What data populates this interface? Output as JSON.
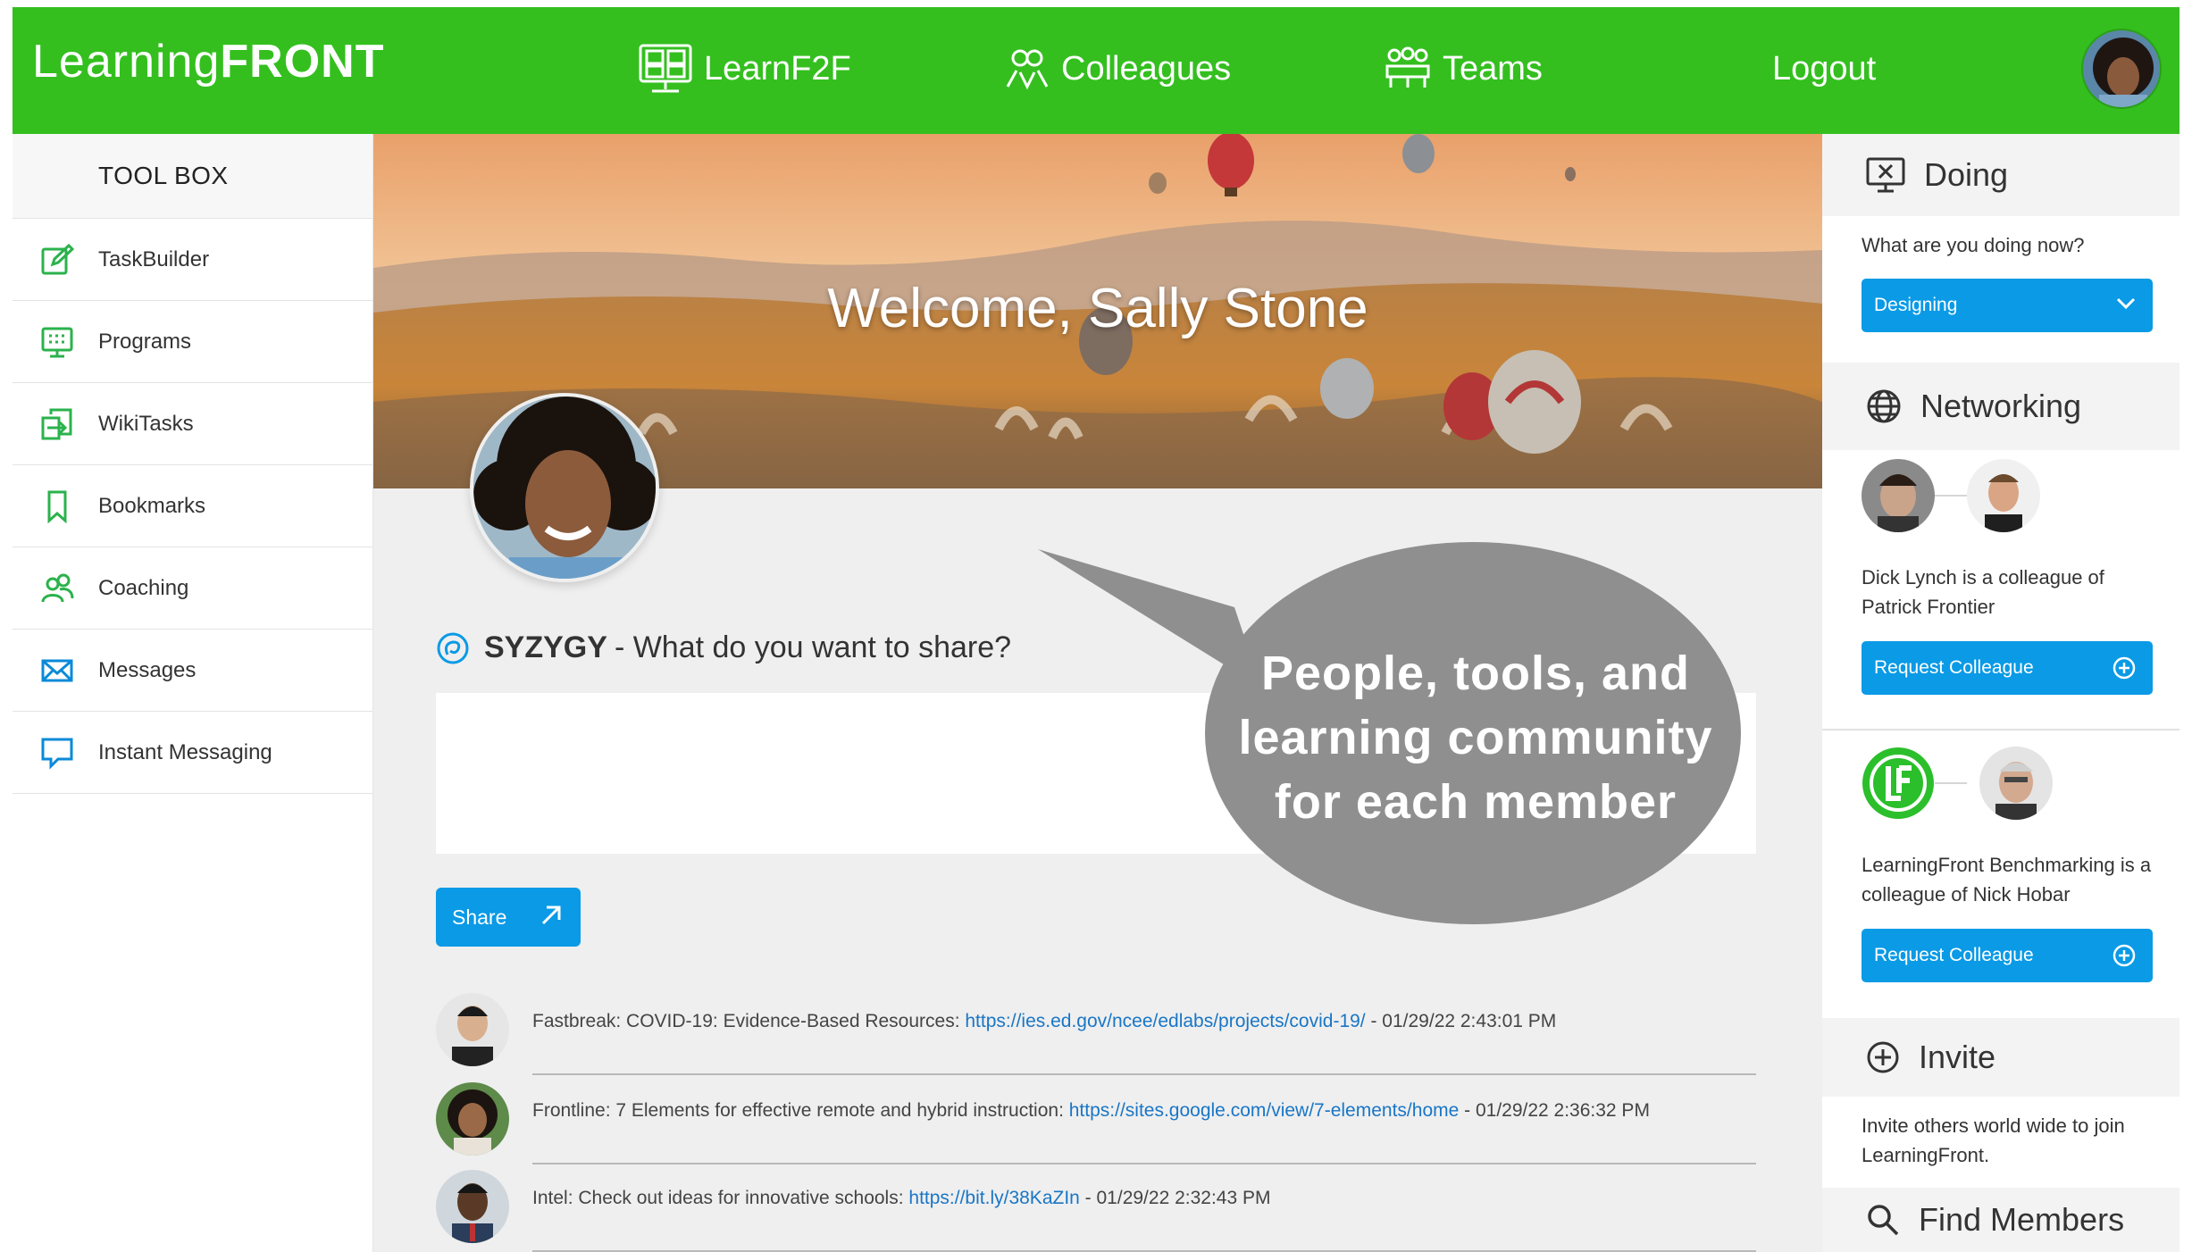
{
  "app": {
    "logo_part1": "Learning",
    "logo_part2": "FRONT"
  },
  "nav": {
    "learnf2f": "LearnF2F",
    "colleagues": "Colleagues",
    "teams": "Teams",
    "logout": "Logout"
  },
  "sidebar": {
    "title": "TOOL BOX",
    "items": [
      {
        "label": "TaskBuilder",
        "icon": "edit-icon"
      },
      {
        "label": "Programs",
        "icon": "monitor-grid-icon"
      },
      {
        "label": "WikiTasks",
        "icon": "import-icon"
      },
      {
        "label": "Bookmarks",
        "icon": "bookmark-icon"
      },
      {
        "label": "Coaching",
        "icon": "users-icon"
      },
      {
        "label": "Messages",
        "icon": "envelope-icon"
      },
      {
        "label": "Instant Messaging",
        "icon": "chat-icon"
      }
    ]
  },
  "main": {
    "welcome": "Welcome, Sally Stone",
    "share_brand": "SYZYGY",
    "share_prompt": "- What do you want to share?",
    "share_button": "Share",
    "callout": {
      "line1": "People, tools, and",
      "line2": "learning community",
      "line3": "for each member"
    },
    "feed": [
      {
        "prefix": "Fastbreak: COVID-19: Evidence-Based Resources: ",
        "link": "https://ies.ed.gov/ncee/edlabs/projects/covid-19/",
        "suffix": " - 01/29/22 2:43:01 PM"
      },
      {
        "prefix": "Frontline: 7 Elements for effective remote and hybrid instruction: ",
        "link": "https://sites.google.com/view/7-elements/home",
        "suffix": " - 01/29/22 2:36:32 PM"
      },
      {
        "prefix": "Intel: Check out ideas for innovative schools: ",
        "link": "https://bit.ly/38KaZIn",
        "suffix": " - 01/29/22 2:32:43 PM"
      }
    ]
  },
  "right": {
    "doing": {
      "title": "Doing",
      "question": "What are you doing now?",
      "selected": "Designing"
    },
    "networking": {
      "title": "Networking",
      "items": [
        {
          "text_line1": "Dick Lynch is a colleague of",
          "text_line2": "Patrick Frontier",
          "button": "Request Colleague"
        },
        {
          "text_line1": "LearningFront Benchmarking is a",
          "text_line2": "colleague of Nick Hobar",
          "button": "Request Colleague"
        }
      ]
    },
    "invite": {
      "title": "Invite",
      "text_line1": "Invite others world wide to join",
      "text_line2": "LearningFront."
    },
    "find": {
      "title": "Find Members"
    }
  },
  "colors": {
    "brand_green": "#34bf1f",
    "button_blue": "#0a9ae6",
    "link_blue": "#1976c6",
    "callout_gray": "#8f8f8f"
  }
}
